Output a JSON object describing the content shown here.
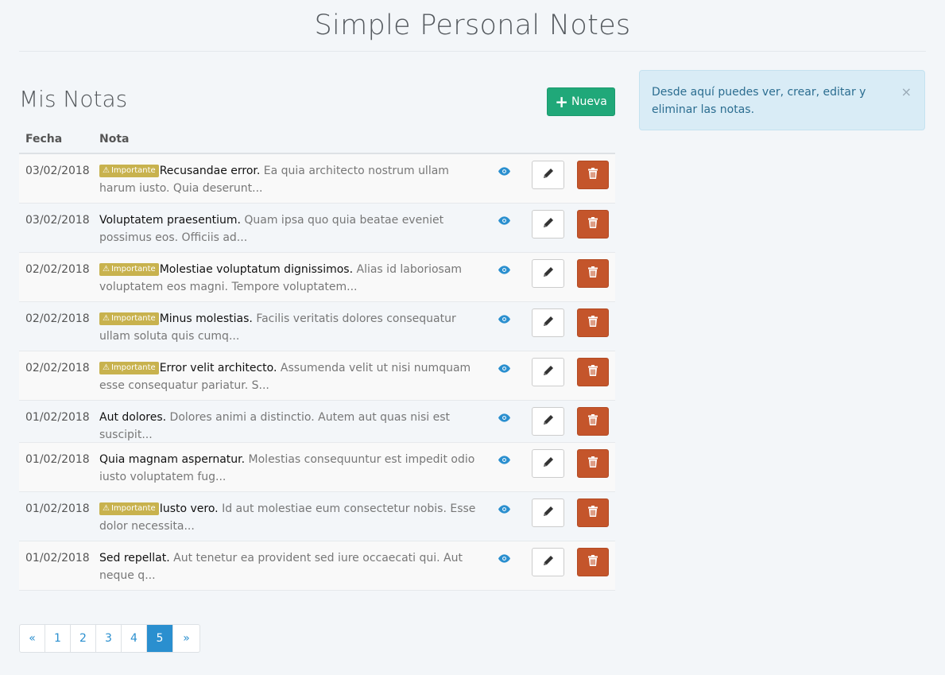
{
  "app_title": "Simple Personal Notes",
  "section_title": "Mis Notas",
  "new_button_label": "Nueva",
  "alert": {
    "text": "Desde aquí puedes ver, crear, editar y eliminar las notas.",
    "close": "×"
  },
  "table": {
    "headers": {
      "fecha": "Fecha",
      "nota": "Nota"
    },
    "badge_label": "Importante",
    "rows": [
      {
        "date": "03/02/2018",
        "important": true,
        "title": "Recusandae error.",
        "excerpt": "Ea quia architecto nostrum ullam harum iusto. Quia deserunt..."
      },
      {
        "date": "03/02/2018",
        "important": false,
        "title": "Voluptatem praesentium.",
        "excerpt": "Quam ipsa quo quia beatae eveniet possimus eos. Officiis ad..."
      },
      {
        "date": "02/02/2018",
        "important": true,
        "title": "Molestiae voluptatum dignissimos.",
        "excerpt": "Alias id laboriosam voluptatem eos magni. Tempore voluptatem..."
      },
      {
        "date": "02/02/2018",
        "important": true,
        "title": "Minus molestias.",
        "excerpt": "Facilis veritatis dolores consequatur ullam soluta quis cumq..."
      },
      {
        "date": "02/02/2018",
        "important": true,
        "title": "Error velit architecto.",
        "excerpt": "Assumenda velit ut nisi numquam esse consequatur pariatur. S..."
      },
      {
        "date": "01/02/2018",
        "important": false,
        "title": "Aut dolores.",
        "excerpt": "Dolores animi a distinctio. Autem aut quas nisi est suscipit..."
      },
      {
        "date": "01/02/2018",
        "important": false,
        "title": "Quia magnam aspernatur.",
        "excerpt": "Molestias consequuntur est impedit odio iusto voluptatem fug..."
      },
      {
        "date": "01/02/2018",
        "important": true,
        "title": "Iusto vero.",
        "excerpt": "Id aut molestiae eum consectetur nobis. Esse dolor necessita..."
      },
      {
        "date": "01/02/2018",
        "important": false,
        "title": "Sed repellat.",
        "excerpt": "Aut tenetur ea provident sed iure occaecati qui. Aut neque q..."
      }
    ]
  },
  "pagination": {
    "items": [
      "«",
      "1",
      "2",
      "3",
      "4",
      "5",
      "»"
    ],
    "active": "5"
  },
  "colors": {
    "accent": "#2a8fcf",
    "success": "#20a879",
    "danger": "#c4552b",
    "warning_badge": "#c8b24e",
    "alert_bg": "#d9ecf6"
  },
  "icons": {
    "new": "plus-icon",
    "badge": "warning-icon",
    "view": "eye-icon",
    "edit": "pencil-icon",
    "delete": "trash-icon",
    "close": "close-icon"
  }
}
